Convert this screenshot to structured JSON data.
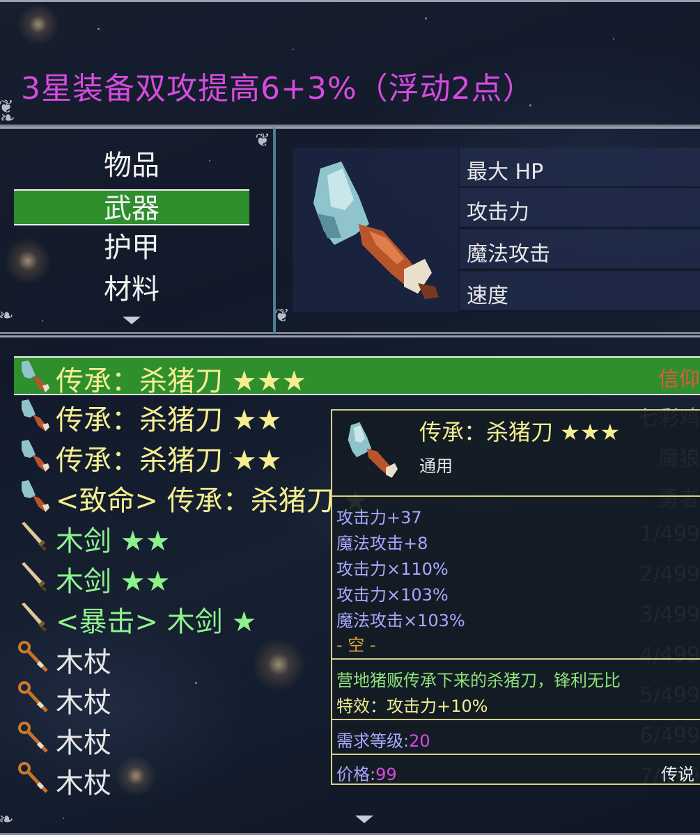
{
  "header": {
    "title": "3星装备双攻提高6+3%（浮动2点）"
  },
  "categories": [
    {
      "label": "物品",
      "selected": false
    },
    {
      "label": "武器",
      "selected": true
    },
    {
      "label": "护甲",
      "selected": false
    },
    {
      "label": "材料",
      "selected": false
    }
  ],
  "stats": {
    "labels": [
      "最大 HP",
      "攻击力",
      "魔法攻击",
      "速度"
    ]
  },
  "items": [
    {
      "name": "传承：杀猪刀 ★★★",
      "right": "信仰",
      "color": "yellow",
      "icon": "cleaver-icon",
      "selected": true
    },
    {
      "name": "传承：杀猪刀 ★★",
      "right": "七彩鸡",
      "color": "yellow",
      "icon": "cleaver-icon",
      "selected": false
    },
    {
      "name": "传承：杀猪刀 ★★",
      "right": "魔狼",
      "color": "yellow",
      "icon": "cleaver-icon",
      "selected": false
    },
    {
      "name": "<致命> 传承：杀猪刀 ★",
      "right": "勇者",
      "color": "yellow",
      "icon": "cleaver-icon",
      "selected": false
    },
    {
      "name": "木剑 ★★",
      "right": "1/499",
      "color": "green",
      "icon": "wooden-sword-icon",
      "selected": false
    },
    {
      "name": "木剑 ★★",
      "right": "2/499",
      "color": "green",
      "icon": "wooden-sword-icon",
      "selected": false
    },
    {
      "name": "<暴击> 木剑 ★",
      "right": "3/499",
      "color": "green",
      "icon": "wooden-sword-icon",
      "selected": false
    },
    {
      "name": "木杖",
      "right": "4/499",
      "color": "white",
      "icon": "wooden-staff-icon",
      "selected": false
    },
    {
      "name": "木杖",
      "right": "5/499",
      "color": "white",
      "icon": "wooden-staff-icon",
      "selected": false
    },
    {
      "name": "木杖",
      "right": "6/499",
      "color": "white",
      "icon": "wooden-staff-icon",
      "selected": false
    },
    {
      "name": "木杖",
      "right": "7/499",
      "color": "white",
      "icon": "wooden-staff-icon",
      "selected": false
    }
  ],
  "tooltip": {
    "title": "传承：杀猪刀 ★★★",
    "subtitle": "通用",
    "stats": [
      "攻击力+37",
      "魔法攻击+8",
      "攻击力×110%",
      "攻击力×103%",
      "魔法攻击×103%"
    ],
    "slot": "- 空 -",
    "description": "营地猪贩传承下来的杀猪刀，锋利无比",
    "effect": "特效：攻击力+10%",
    "level_label": "需求等级:",
    "level_value": "20",
    "price_label": "价格:",
    "price_value": "99",
    "rarity": "传说"
  },
  "colors": {
    "title": "#d64be0",
    "selection": "#2f8f2d",
    "item_yellow": "#f5ee90",
    "item_green": "#8ef28c",
    "item_white": "#e6e6e6",
    "stat_blue": "#a9a7ff",
    "slot_orange": "#e8a23a",
    "desc_green": "#8ee27a",
    "value_magenta": "#d64be0"
  }
}
